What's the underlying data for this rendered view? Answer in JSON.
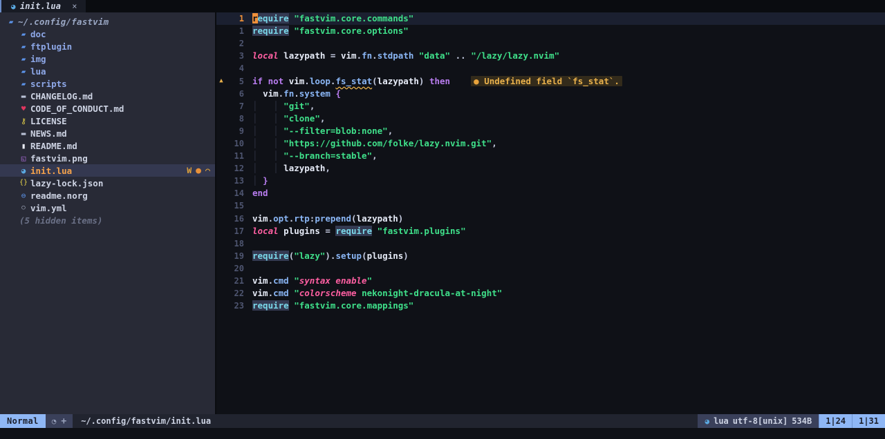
{
  "app": {
    "name": "neovim",
    "theme": "nekonight-dracula-at-night"
  },
  "tabline": {
    "tabs": [
      {
        "icon": "lua-file-icon",
        "icon_glyph": "◕",
        "label": "init.lua",
        "close_glyph": "×",
        "active": true
      }
    ]
  },
  "sidebar": {
    "title": "neo-tree-file-explorer",
    "root": {
      "chevron": "▾",
      "icon_glyph": "▰",
      "label": "~/.config/fastvim"
    },
    "items": [
      {
        "kind": "dir",
        "label": "doc",
        "icon": "folder-icon",
        "icon_glyph": "▰",
        "icon_color": "#5c93e8"
      },
      {
        "kind": "dir",
        "label": "ftplugin",
        "icon": "folder-icon",
        "icon_glyph": "▰",
        "icon_color": "#5c93e8"
      },
      {
        "kind": "dir",
        "label": "img",
        "icon": "folder-icon",
        "icon_glyph": "▰",
        "icon_color": "#5c93e8"
      },
      {
        "kind": "dir",
        "label": "lua",
        "icon": "folder-icon",
        "icon_glyph": "▰",
        "icon_color": "#5c93e8"
      },
      {
        "kind": "dir",
        "label": "scripts",
        "icon": "folder-icon",
        "icon_glyph": "▰",
        "icon_color": "#5c93e8"
      },
      {
        "kind": "file",
        "label": "CHANGELOG.md",
        "icon": "markdown-icon",
        "icon_glyph": "▬",
        "icon_color": "#b8c0d4"
      },
      {
        "kind": "file",
        "label": "CODE_OF_CONDUCT.md",
        "icon": "heart-icon",
        "icon_glyph": "♥",
        "icon_color": "#e0365f"
      },
      {
        "kind": "file",
        "label": "LICENSE",
        "icon": "license-key-icon",
        "icon_glyph": "⚷",
        "icon_color": "#e8d44a"
      },
      {
        "kind": "file",
        "label": "NEWS.md",
        "icon": "markdown-icon",
        "icon_glyph": "▬",
        "icon_color": "#b8c0d4"
      },
      {
        "kind": "file",
        "label": "README.md",
        "icon": "book-icon",
        "icon_glyph": "▮",
        "icon_color": "#e8eaf2"
      },
      {
        "kind": "file",
        "label": "fastvim.png",
        "icon": "image-icon",
        "icon_glyph": "◱",
        "icon_color": "#b06fe0"
      },
      {
        "kind": "file",
        "label": "init.lua",
        "icon": "lua-file-icon",
        "icon_glyph": "◕",
        "icon_color": "#5aa8e0",
        "selected": true,
        "diagnostics": {
          "warning_label": "W",
          "dot": "●",
          "truncated": "◠"
        }
      },
      {
        "kind": "file",
        "label": "lazy-lock.json",
        "icon": "json-icon",
        "icon_glyph": "{}",
        "icon_color": "#e8d44a"
      },
      {
        "kind": "file",
        "label": "readme.norg",
        "icon": "neorg-icon",
        "icon_glyph": "⊖",
        "icon_color": "#5c93e8"
      },
      {
        "kind": "file",
        "label": "vim.yml",
        "icon": "yaml-icon",
        "icon_glyph": "○",
        "icon_color": "#b8c0d4"
      },
      {
        "kind": "hidden",
        "label": "(5 hidden items)",
        "icon": "",
        "icon_glyph": "",
        "icon_color": ""
      }
    ]
  },
  "editor": {
    "filename": "init.lua",
    "cursor_char": "r",
    "diagnostic": {
      "dot": "●",
      "text": "Undefined field `fs_stat`.",
      "severity": "warning",
      "sign": "▲",
      "line": 5
    },
    "lines": [
      {
        "num": "1",
        "rel": "1",
        "current": true
      },
      {
        "num": "1",
        "rel": "1"
      },
      {
        "num": "2",
        "rel": "2"
      },
      {
        "num": "3",
        "rel": "3"
      },
      {
        "num": "4",
        "rel": "4"
      },
      {
        "num": "5",
        "rel": "5"
      },
      {
        "num": "6",
        "rel": "6"
      },
      {
        "num": "7",
        "rel": "7"
      },
      {
        "num": "8",
        "rel": "8"
      },
      {
        "num": "9",
        "rel": "9"
      },
      {
        "num": "10",
        "rel": "10"
      },
      {
        "num": "11",
        "rel": "11"
      },
      {
        "num": "12",
        "rel": "12"
      },
      {
        "num": "13",
        "rel": "13"
      },
      {
        "num": "14",
        "rel": "14"
      },
      {
        "num": "15",
        "rel": "15"
      },
      {
        "num": "16",
        "rel": "16"
      },
      {
        "num": "17",
        "rel": "17"
      },
      {
        "num": "18",
        "rel": "18"
      },
      {
        "num": "19",
        "rel": "19"
      },
      {
        "num": "20",
        "rel": "20"
      },
      {
        "num": "21",
        "rel": "21"
      },
      {
        "num": "22",
        "rel": "22"
      },
      {
        "num": "23",
        "rel": "23"
      }
    ],
    "source": [
      "require \"fastvim.core.commands\"",
      "require \"fastvim.core.options\"",
      "",
      "local lazypath = vim.fn.stdpath \"data\" .. \"/lazy/lazy.nvim\"",
      "",
      "if not vim.loop.fs_stat(lazypath) then",
      "  vim.fn.system {",
      "    \"git\",",
      "    \"clone\",",
      "    \"--filter=blob:none\",",
      "    \"https://github.com/folke/lazy.nvim.git\",",
      "    \"--branch=stable\",",
      "    lazypath,",
      "  }",
      "end",
      "",
      "vim.opt.rtp:prepend(lazypath)",
      "local plugins = require \"fastvim.plugins\"",
      "",
      "require(\"lazy\").setup(plugins)",
      "",
      "vim.cmd \"syntax enable\"",
      "vim.cmd \"colorscheme nekonight-dracula-at-night\"",
      "require \"fastvim.core.mappings\""
    ]
  },
  "statusline": {
    "mode": "Normal",
    "git_clock_icon": "◔",
    "git_added_icon": "+",
    "path": "~/.config/fastvim/init.lua",
    "filetype_icon": "lua-file-icon",
    "filetype_icon_glyph": "◕",
    "filetype": "lua",
    "encoding": "utf-8[unix]",
    "filesize": "534B",
    "position_left": "1|24",
    "position_right": "1|31"
  },
  "colors": {
    "sidebar_bg": "#282a36",
    "editor_bg": "#0f1117",
    "tabline_bg": "#0a0c10",
    "cursorline_bg": "#1b2030",
    "accent_blue": "#8fb7f5",
    "cursor_orange": "#f0913a",
    "warning": "#e8b04b",
    "string_green": "#3fe08a",
    "keyword_purple": "#b97df0",
    "function_cyan": "#6fd6e8",
    "local_pink": "#ff5fa2"
  }
}
